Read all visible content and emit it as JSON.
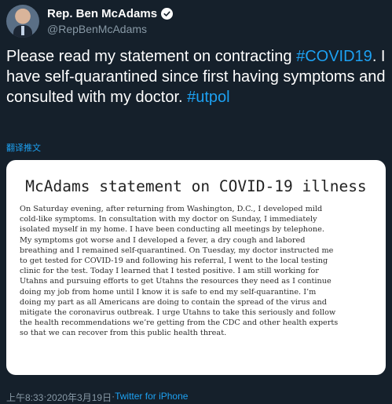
{
  "author": {
    "display_name": "Rep. Ben McAdams",
    "handle": "@RepBenMcAdams",
    "verified": true
  },
  "tweet": {
    "text_before": "Please read my statement on contracting ",
    "hashtag1": "#COVID19",
    "text_after": ". I have self-quarantined since first having symptoms and consulted with my doctor. ",
    "hashtag2": "#utpol",
    "translate_label": "翻译推文"
  },
  "statement_card": {
    "title": "McAdams statement on COVID-19 illness",
    "lines": [
      "On Saturday evening, after returning from Washington, D.C., I developed mild",
      "cold-like symptoms. In consultation with my doctor on Sunday, I immediately",
      "isolated myself in my home. I have been conducting all meetings by telephone.",
      "My symptoms got worse and I developed a fever, a dry cough and labored",
      "breathing and I remained self-quarantined. On Tuesday, my doctor instructed me",
      "to get tested for COVID-19 and following his referral, I went to the local testing",
      "clinic for the test. Today I learned that I tested positive.  I am still working for",
      "Utahns and pursuing efforts to get Utahns the resources they need as I continue",
      "doing my job from home until I know it is safe to end my self-quarantine. I’m",
      "doing my part as all Americans are doing to contain the spread of the virus and",
      "mitigate the coronavirus outbreak. I urge Utahns to take this seriously and follow",
      "the health recommendations we’re getting from the CDC and other health experts",
      "so that we can recover from this public health threat."
    ]
  },
  "meta": {
    "time": "上午8:33",
    "separator": " · ",
    "date": "2020年3月19日",
    "source": "Twitter for iPhone"
  },
  "colors": {
    "background": "#15202b",
    "link": "#1da1f2",
    "muted": "#8899a6"
  }
}
